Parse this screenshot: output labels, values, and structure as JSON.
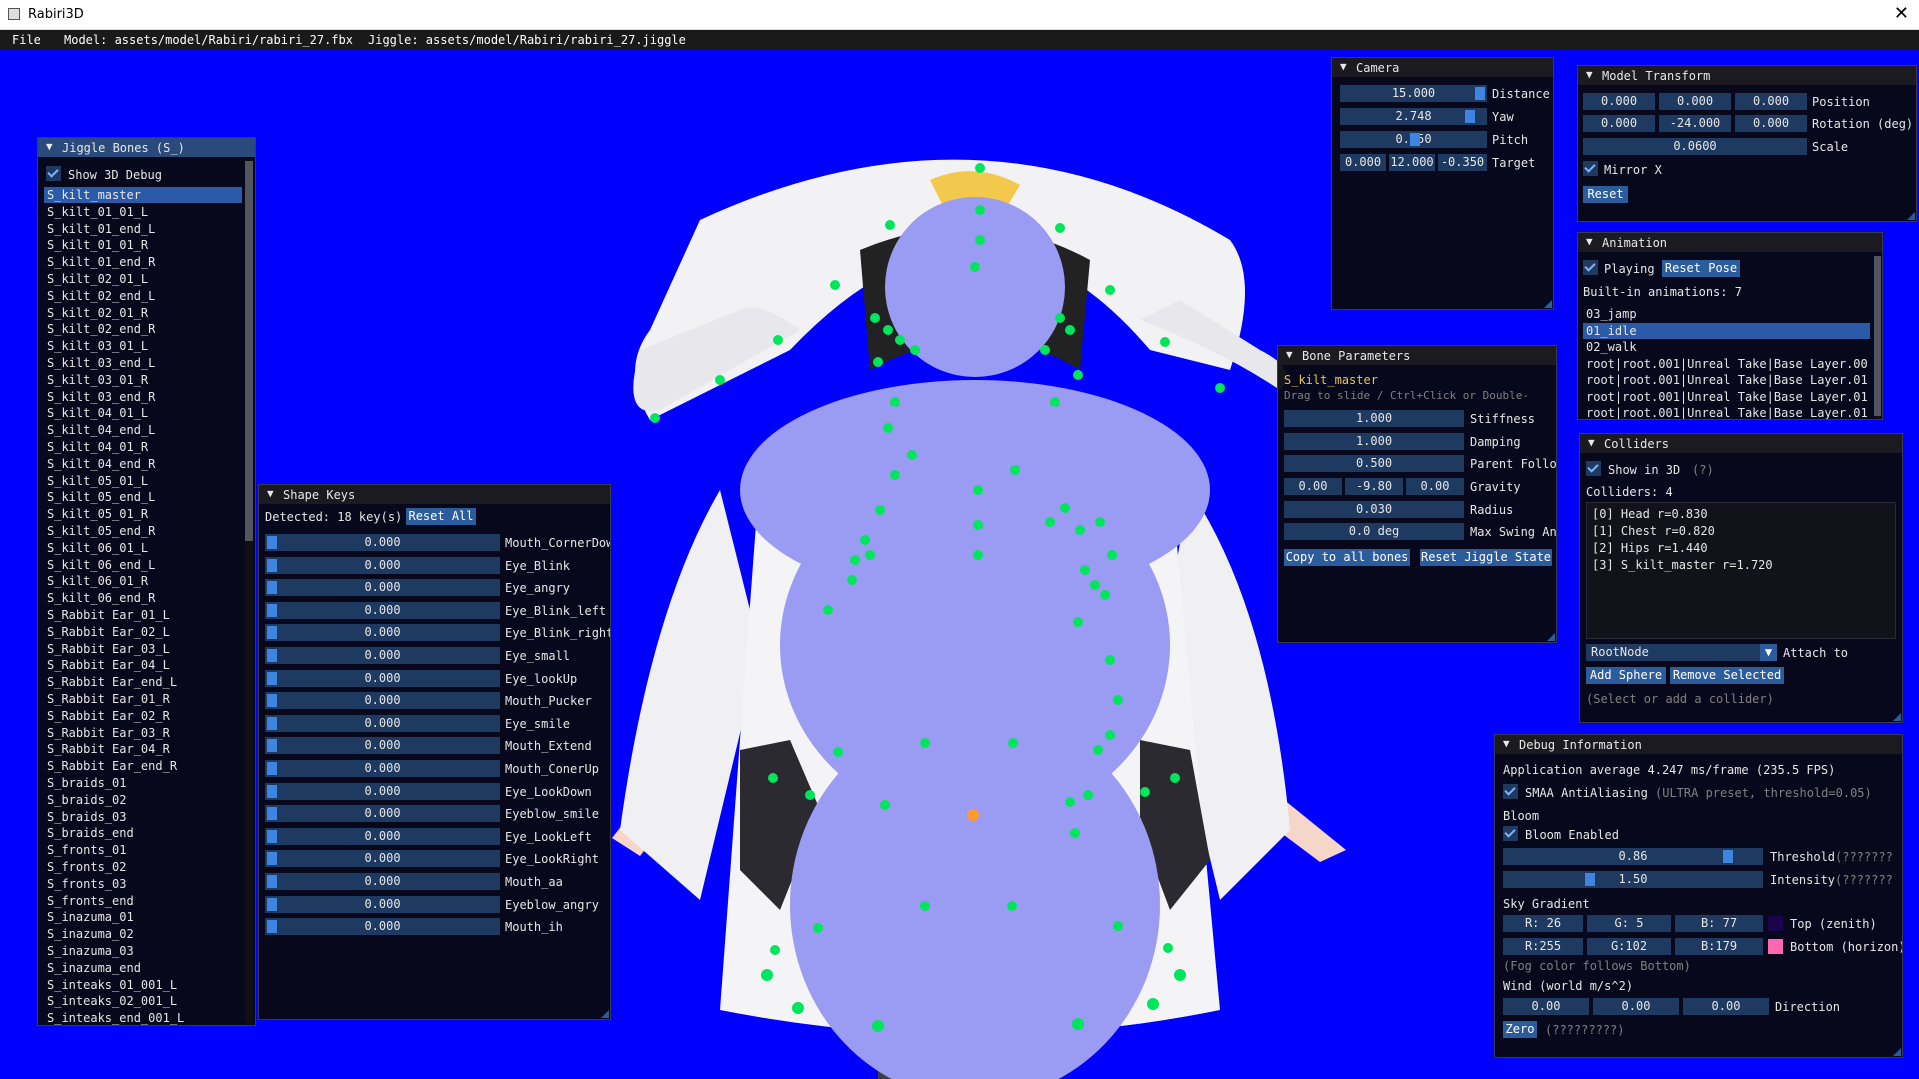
{
  "window": {
    "title": "Rabiri3D",
    "close": "✕"
  },
  "menubar": {
    "file": "File",
    "model": "Model: assets/model/Rabiri/rabiri_27.fbx",
    "jiggle": "Jiggle: assets/model/Rabiri/rabiri_27.jiggle"
  },
  "colors": {
    "background": "#0000ff",
    "panel": "#08080e",
    "accent": "#2b5d9c",
    "frame": "#1e3a60",
    "joint": "#00e65c",
    "collider": "#9a9cf4"
  },
  "jiggle_bones": {
    "title": "Jiggle Bones (S_)",
    "show_debug": "Show 3D Debug",
    "items": [
      "S_kilt_master",
      "S_kilt_01_01_L",
      "S_kilt_01_end_L",
      "S_kilt_01_01_R",
      "S_kilt_01_end_R",
      "S_kilt_02_01_L",
      "S_kilt_02_end_L",
      "S_kilt_02_01_R",
      "S_kilt_02_end_R",
      "S_kilt_03_01_L",
      "S_kilt_03_end_L",
      "S_kilt_03_01_R",
      "S_kilt_03_end_R",
      "S_kilt_04_01_L",
      "S_kilt_04_end_L",
      "S_kilt_04_01_R",
      "S_kilt_04_end_R",
      "S_kilt_05_01_L",
      "S_kilt_05_end_L",
      "S_kilt_05_01_R",
      "S_kilt_05_end_R",
      "S_kilt_06_01_L",
      "S_kilt_06_end_L",
      "S_kilt_06_01_R",
      "S_kilt_06_end_R",
      "S_Rabbit Ear_01_L",
      "S_Rabbit Ear_02_L",
      "S_Rabbit Ear_03_L",
      "S_Rabbit Ear_04_L",
      "S_Rabbit Ear_end_L",
      "S_Rabbit Ear_01_R",
      "S_Rabbit Ear_02_R",
      "S_Rabbit Ear_03_R",
      "S_Rabbit Ear_04_R",
      "S_Rabbit Ear_end_R",
      "S_braids_01",
      "S_braids_02",
      "S_braids_03",
      "S_braids_end",
      "S_fronts_01",
      "S_fronts_02",
      "S_fronts_03",
      "S_fronts_end",
      "S_inazuma_01",
      "S_inazuma_02",
      "S_inazuma_03",
      "S_inazuma_end",
      "S_inteaks_01_001_L",
      "S_inteaks_02_001_L",
      "S_inteaks_end_001_L"
    ]
  },
  "shape_keys": {
    "title": "Shape Keys",
    "detected": "Detected: 18 key(s)",
    "reset_all": "Reset All",
    "keys": [
      {
        "name": "Mouth_CornerDown",
        "value": "0.000"
      },
      {
        "name": "Eye_Blink",
        "value": "0.000"
      },
      {
        "name": "Eye_angry",
        "value": "0.000"
      },
      {
        "name": "Eye_Blink_left",
        "value": "0.000"
      },
      {
        "name": "Eye_Blink_right",
        "value": "0.000"
      },
      {
        "name": "Eye_small",
        "value": "0.000"
      },
      {
        "name": "Eye_lookUp",
        "value": "0.000"
      },
      {
        "name": "Mouth_Pucker",
        "value": "0.000"
      },
      {
        "name": "Eye_smile",
        "value": "0.000"
      },
      {
        "name": "Mouth_Extend",
        "value": "0.000"
      },
      {
        "name": "Mouth_ConerUp",
        "value": "0.000"
      },
      {
        "name": "Eye_LookDown",
        "value": "0.000"
      },
      {
        "name": "Eyeblow_smile",
        "value": "0.000"
      },
      {
        "name": "Eye_LookLeft",
        "value": "0.000"
      },
      {
        "name": "Eye_LookRight",
        "value": "0.000"
      },
      {
        "name": "Mouth_aa",
        "value": "0.000"
      },
      {
        "name": "Eyeblow_angry",
        "value": "0.000"
      },
      {
        "name": "Mouth_ih",
        "value": "0.000"
      }
    ]
  },
  "camera": {
    "title": "Camera",
    "distance": {
      "value": "15.000",
      "label": "Distance"
    },
    "yaw": {
      "value": "2.748",
      "label": "Yaw"
    },
    "pitch": {
      "value": "0.050",
      "label": "Pitch"
    },
    "target": {
      "x": "0.000",
      "y": "12.000",
      "z": "-0.350",
      "label": "Target"
    }
  },
  "model_transform": {
    "title": "Model Transform",
    "position": {
      "x": "0.000",
      "y": "0.000",
      "z": "0.000",
      "label": "Position"
    },
    "rotation": {
      "x": "0.000",
      "y": "-24.000",
      "z": "0.000",
      "label": "Rotation (deg)"
    },
    "scale": {
      "value": "0.0600",
      "label": "Scale"
    },
    "mirror": "Mirror X",
    "reset": "Reset"
  },
  "animation": {
    "title": "Animation",
    "playing": "Playing",
    "reset_pose": "Reset Pose",
    "builtin": "Built-in animations: 7",
    "items": [
      "03_jamp",
      "01_idle",
      "02_walk",
      "root|root.001|Unreal Take|Base Layer.00",
      "root|root.001|Unreal Take|Base Layer.01",
      "root|root.001|Unreal Take|Base Layer.01",
      "root|root.001|Unreal Take|Base Layer.01"
    ]
  },
  "bone_params": {
    "title": "Bone Parameters",
    "bone": "S_kilt_master",
    "hint": "Drag to slide  /  Ctrl+Click or Double-",
    "stiffness": {
      "value": "1.000",
      "label": "Stiffness"
    },
    "damping": {
      "value": "1.000",
      "label": "Damping"
    },
    "parent_follow": {
      "value": "0.500",
      "label": "Parent Follo"
    },
    "gravity": {
      "x": "0.00",
      "y": "-9.80",
      "z": "0.00",
      "label": "Gravity"
    },
    "radius": {
      "value": "0.030",
      "label": "Radius"
    },
    "max_swing": {
      "value": "0.0 deg",
      "label": "Max Swing An"
    },
    "copy_all": "Copy to all bones",
    "reset_jiggle": "Reset Jiggle State"
  },
  "colliders": {
    "title": "Colliders",
    "show": "Show in 3D",
    "help": "(?)",
    "count": "Colliders: 4",
    "items": [
      "[0] Head  r=0.830",
      "[1] Chest  r=0.820",
      "[2] Hips  r=1.440",
      "[3] S_kilt_master  r=1.720"
    ],
    "attach_value": "RootNode",
    "attach_label": "Attach to",
    "add": "Add Sphere",
    "remove": "Remove Selected",
    "hint": "(Select or add a collider)"
  },
  "debug": {
    "title": "Debug Information",
    "fps": "Application average 4.247 ms/frame (235.5 FPS)",
    "smaa": "SMAA AntiAliasing",
    "smaa_note": "(ULTRA preset, threshold=0.05)",
    "bloom_header": "Bloom",
    "bloom_enabled": "Bloom Enabled",
    "threshold": {
      "value": "0.86",
      "label": "Threshold",
      "note": "(???????"
    },
    "intensity": {
      "value": "1.50",
      "label": "Intensity",
      "note": "(???????"
    },
    "sky_header": "Sky Gradient",
    "top": {
      "r": "R: 26",
      "g": "G:  5",
      "b": "B: 77",
      "label": "Top (zenith)",
      "color": "#1a054d"
    },
    "bottom": {
      "r": "R:255",
      "g": "G:102",
      "b": "B:179",
      "label": "Bottom (horizon)",
      "color": "#ff66b3"
    },
    "fog_note": "(Fog color follows Bottom)",
    "wind_header": "Wind (world m/s^2)",
    "wind": {
      "x": "0.00",
      "y": "0.00",
      "z": "0.00",
      "label": "Direction"
    },
    "zero": "Zero",
    "zero_note": "(?????????)"
  }
}
